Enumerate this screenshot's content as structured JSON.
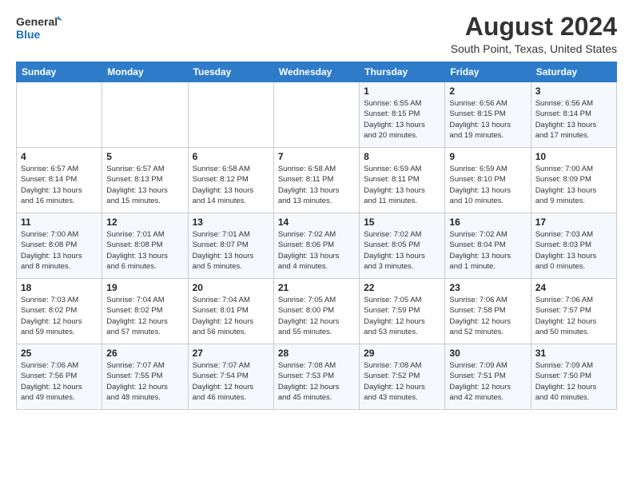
{
  "logo": {
    "line1": "General",
    "line2": "Blue"
  },
  "title": "August 2024",
  "location": "South Point, Texas, United States",
  "days_of_week": [
    "Sunday",
    "Monday",
    "Tuesday",
    "Wednesday",
    "Thursday",
    "Friday",
    "Saturday"
  ],
  "weeks": [
    [
      {
        "day": "",
        "info": ""
      },
      {
        "day": "",
        "info": ""
      },
      {
        "day": "",
        "info": ""
      },
      {
        "day": "",
        "info": ""
      },
      {
        "day": "1",
        "info": "Sunrise: 6:55 AM\nSunset: 8:15 PM\nDaylight: 13 hours\nand 20 minutes."
      },
      {
        "day": "2",
        "info": "Sunrise: 6:56 AM\nSunset: 8:15 PM\nDaylight: 13 hours\nand 19 minutes."
      },
      {
        "day": "3",
        "info": "Sunrise: 6:56 AM\nSunset: 8:14 PM\nDaylight: 13 hours\nand 17 minutes."
      }
    ],
    [
      {
        "day": "4",
        "info": "Sunrise: 6:57 AM\nSunset: 8:14 PM\nDaylight: 13 hours\nand 16 minutes."
      },
      {
        "day": "5",
        "info": "Sunrise: 6:57 AM\nSunset: 8:13 PM\nDaylight: 13 hours\nand 15 minutes."
      },
      {
        "day": "6",
        "info": "Sunrise: 6:58 AM\nSunset: 8:12 PM\nDaylight: 13 hours\nand 14 minutes."
      },
      {
        "day": "7",
        "info": "Sunrise: 6:58 AM\nSunset: 8:11 PM\nDaylight: 13 hours\nand 13 minutes."
      },
      {
        "day": "8",
        "info": "Sunrise: 6:59 AM\nSunset: 8:11 PM\nDaylight: 13 hours\nand 11 minutes."
      },
      {
        "day": "9",
        "info": "Sunrise: 6:59 AM\nSunset: 8:10 PM\nDaylight: 13 hours\nand 10 minutes."
      },
      {
        "day": "10",
        "info": "Sunrise: 7:00 AM\nSunset: 8:09 PM\nDaylight: 13 hours\nand 9 minutes."
      }
    ],
    [
      {
        "day": "11",
        "info": "Sunrise: 7:00 AM\nSunset: 8:08 PM\nDaylight: 13 hours\nand 8 minutes."
      },
      {
        "day": "12",
        "info": "Sunrise: 7:01 AM\nSunset: 8:08 PM\nDaylight: 13 hours\nand 6 minutes."
      },
      {
        "day": "13",
        "info": "Sunrise: 7:01 AM\nSunset: 8:07 PM\nDaylight: 13 hours\nand 5 minutes."
      },
      {
        "day": "14",
        "info": "Sunrise: 7:02 AM\nSunset: 8:06 PM\nDaylight: 13 hours\nand 4 minutes."
      },
      {
        "day": "15",
        "info": "Sunrise: 7:02 AM\nSunset: 8:05 PM\nDaylight: 13 hours\nand 3 minutes."
      },
      {
        "day": "16",
        "info": "Sunrise: 7:02 AM\nSunset: 8:04 PM\nDaylight: 13 hours\nand 1 minute."
      },
      {
        "day": "17",
        "info": "Sunrise: 7:03 AM\nSunset: 8:03 PM\nDaylight: 13 hours\nand 0 minutes."
      }
    ],
    [
      {
        "day": "18",
        "info": "Sunrise: 7:03 AM\nSunset: 8:02 PM\nDaylight: 12 hours\nand 59 minutes."
      },
      {
        "day": "19",
        "info": "Sunrise: 7:04 AM\nSunset: 8:02 PM\nDaylight: 12 hours\nand 57 minutes."
      },
      {
        "day": "20",
        "info": "Sunrise: 7:04 AM\nSunset: 8:01 PM\nDaylight: 12 hours\nand 56 minutes."
      },
      {
        "day": "21",
        "info": "Sunrise: 7:05 AM\nSunset: 8:00 PM\nDaylight: 12 hours\nand 55 minutes."
      },
      {
        "day": "22",
        "info": "Sunrise: 7:05 AM\nSunset: 7:59 PM\nDaylight: 12 hours\nand 53 minutes."
      },
      {
        "day": "23",
        "info": "Sunrise: 7:06 AM\nSunset: 7:58 PM\nDaylight: 12 hours\nand 52 minutes."
      },
      {
        "day": "24",
        "info": "Sunrise: 7:06 AM\nSunset: 7:57 PM\nDaylight: 12 hours\nand 50 minutes."
      }
    ],
    [
      {
        "day": "25",
        "info": "Sunrise: 7:06 AM\nSunset: 7:56 PM\nDaylight: 12 hours\nand 49 minutes."
      },
      {
        "day": "26",
        "info": "Sunrise: 7:07 AM\nSunset: 7:55 PM\nDaylight: 12 hours\nand 48 minutes."
      },
      {
        "day": "27",
        "info": "Sunrise: 7:07 AM\nSunset: 7:54 PM\nDaylight: 12 hours\nand 46 minutes."
      },
      {
        "day": "28",
        "info": "Sunrise: 7:08 AM\nSunset: 7:53 PM\nDaylight: 12 hours\nand 45 minutes."
      },
      {
        "day": "29",
        "info": "Sunrise: 7:08 AM\nSunset: 7:52 PM\nDaylight: 12 hours\nand 43 minutes."
      },
      {
        "day": "30",
        "info": "Sunrise: 7:09 AM\nSunset: 7:51 PM\nDaylight: 12 hours\nand 42 minutes."
      },
      {
        "day": "31",
        "info": "Sunrise: 7:09 AM\nSunset: 7:50 PM\nDaylight: 12 hours\nand 40 minutes."
      }
    ]
  ]
}
